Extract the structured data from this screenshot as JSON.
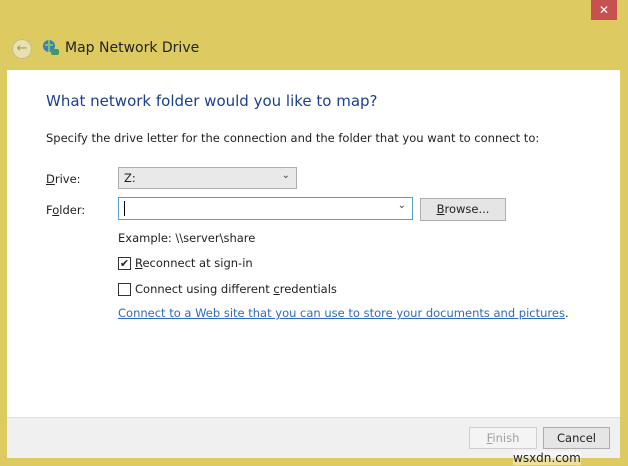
{
  "window": {
    "title": "Map Network Drive",
    "close": "✕",
    "back": "←"
  },
  "heading": "What network folder would you like to map?",
  "description": "Specify the drive letter for the connection and the folder that you want to connect to:",
  "drive": {
    "label_prefix": "",
    "label_u": "D",
    "label_rest": "rive:",
    "value": "Z:"
  },
  "folder": {
    "label_prefix": "F",
    "label_u": "o",
    "label_rest": "lder:",
    "value": ""
  },
  "browse": {
    "u": "B",
    "rest": "rowse..."
  },
  "example": "Example: \\\\server\\share",
  "reconnect": {
    "checked": true,
    "u": "R",
    "rest": "econnect at sign-in",
    "check": "✔"
  },
  "credentials": {
    "checked": false,
    "pre": "Connect using different ",
    "u": "c",
    "rest": "redentials"
  },
  "link": "Connect to a Web site that you can use to store your documents and pictures",
  "link_period": ".",
  "footer": {
    "finish_u": "F",
    "finish_rest": "inish",
    "cancel": "Cancel"
  },
  "watermark": "wsxdn.com"
}
